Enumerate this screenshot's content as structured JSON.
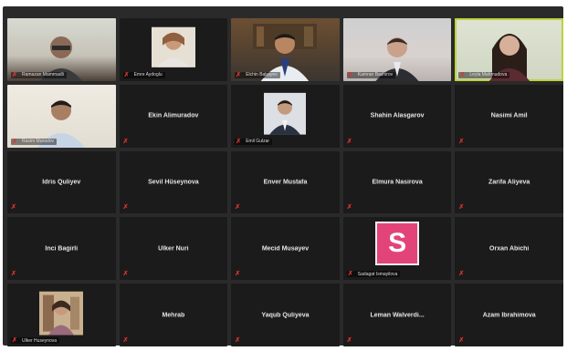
{
  "participants": [
    {
      "name": "Ramazan Mammadli",
      "type": "video"
    },
    {
      "name": "Emre Aydoglu",
      "type": "thumb"
    },
    {
      "name": "Elchin Babayev",
      "type": "video"
    },
    {
      "name": "Kamran Bashirov",
      "type": "video"
    },
    {
      "name": "Leyla Mahmudova",
      "type": "video",
      "active": true
    },
    {
      "name": "Rasim Muradov",
      "type": "video"
    },
    {
      "name": "Ekin Alimuradov",
      "type": "text"
    },
    {
      "name": "Emil Gulzar",
      "type": "thumb"
    },
    {
      "name": "Shahin Alasgarov",
      "type": "text"
    },
    {
      "name": "Nasimi Amil",
      "type": "text"
    },
    {
      "name": "Idris Quliyev",
      "type": "text"
    },
    {
      "name": "Sevil Hüseynova",
      "type": "text"
    },
    {
      "name": "Enver Mustafa",
      "type": "text"
    },
    {
      "name": "Elmura Nasirova",
      "type": "text"
    },
    {
      "name": "Zarifa Aliyeva",
      "type": "text"
    },
    {
      "name": "Inci Bagirli",
      "type": "text"
    },
    {
      "name": "Ulker Nuri",
      "type": "text"
    },
    {
      "name": "Mecid Musayev",
      "type": "text"
    },
    {
      "name": "Sadagat Ismayilova",
      "type": "avatar",
      "initial": "S"
    },
    {
      "name": "Orxan Abichi",
      "type": "text"
    },
    {
      "name": "Ulker Huseynova",
      "type": "thumb"
    },
    {
      "name": "Mehrab",
      "type": "text"
    },
    {
      "name": "Yaqub Quliyeva",
      "type": "text"
    },
    {
      "name": "Leman Walverdi...",
      "type": "text"
    },
    {
      "name": "Azam Ibrahimova",
      "type": "text"
    }
  ],
  "colors": {
    "muted_icon": "#e0332a",
    "active_speaker_border": "#bfd23a",
    "avatar_pink": "#e2447a",
    "tile_bg": "#1b1b1b"
  },
  "icons": {
    "mute": "microphone-muted-icon"
  }
}
